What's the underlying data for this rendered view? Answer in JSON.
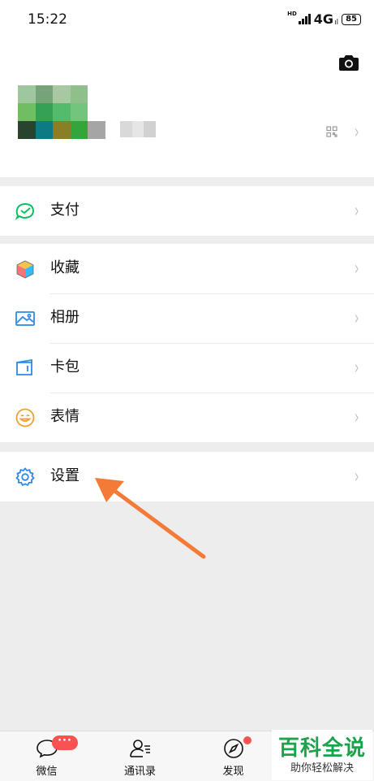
{
  "status_bar": {
    "time": "15:22",
    "hd_label": "HD",
    "network": "4G",
    "network_suffix": "ıl",
    "battery": "85"
  },
  "profile": {
    "camera_icon": "camera-icon",
    "qr_icon": "qr-code-icon",
    "avatar_colors": [
      "#9fc79d",
      "#76a378",
      "#a7c8a0",
      "#8fc08b",
      "#ffffff",
      "#6fbf62",
      "#35a155",
      "#54bb6c",
      "#72c57b",
      "#ffffff",
      "#29442e",
      "#0e7a83",
      "#8a7f26",
      "#33a53a",
      "#a5a5a5"
    ],
    "name_colors": [
      "#d9d9d9",
      "#e6e6e6",
      "#d1d1d1"
    ]
  },
  "menu": {
    "pay": {
      "label": "支付",
      "icon": "wechat-pay-icon"
    },
    "favorites": {
      "label": "收藏",
      "icon": "cube-favorites-icon"
    },
    "album": {
      "label": "相册",
      "icon": "photo-album-icon"
    },
    "cards": {
      "label": "卡包",
      "icon": "card-wallet-icon"
    },
    "stickers": {
      "label": "表情",
      "icon": "smiley-icon"
    },
    "settings": {
      "label": "设置",
      "icon": "gear-icon"
    }
  },
  "tabbar": {
    "chats": {
      "label": "微信",
      "badge": "···",
      "icon": "chat-bubble-icon"
    },
    "contacts": {
      "label": "通讯录",
      "icon": "contacts-icon"
    },
    "discover": {
      "label": "发现",
      "icon": "compass-icon"
    }
  },
  "watermark": {
    "title": "百科全说",
    "subtitle": "助你轻松解决"
  },
  "colors": {
    "accent_green": "#07c160",
    "badge_red": "#fa5151",
    "arrow_orange": "#f47a37",
    "background": "#ededed"
  }
}
